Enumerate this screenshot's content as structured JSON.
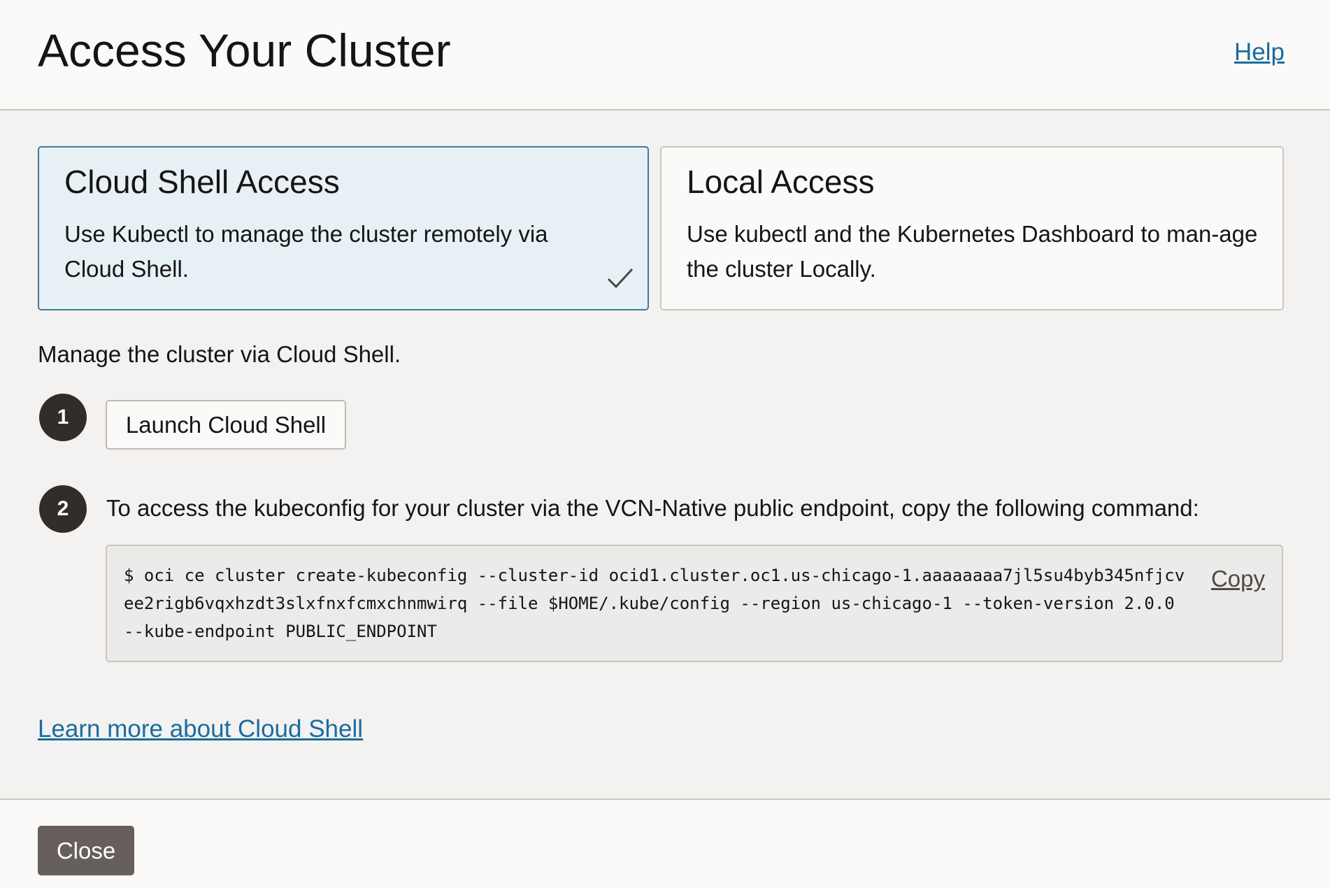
{
  "header": {
    "title": "Access Your Cluster",
    "help_label": "Help"
  },
  "cards": [
    {
      "title": "Cloud Shell Access",
      "description": "Use Kubectl to manage the cluster remotely via Cloud Shell.",
      "selected": true,
      "icon": "checkmark-icon"
    },
    {
      "title": "Local Access",
      "description": "Use kubectl and the Kubernetes Dashboard to man-age the cluster Locally.",
      "selected": false
    }
  ],
  "intro": "Manage the cluster via Cloud Shell.",
  "steps": [
    {
      "number": "1",
      "button_label": "Launch Cloud Shell"
    },
    {
      "number": "2",
      "text": "To access the kubeconfig for your cluster via the VCN-Native public endpoint, copy the following command:"
    }
  ],
  "command": {
    "text": "$ oci ce cluster create-kubeconfig --cluster-id ocid1.cluster.oc1.us-chicago-1.aaaaaaaa7jl5su4byb345nfjcvee2rigb6vqxhzdt3slxfnxfcmxchnmwirq --file $HOME/.kube/config --region us-chicago-1 --token-version 2.0.0 --kube-endpoint PUBLIC_ENDPOINT",
    "copy_label": "Copy"
  },
  "learn_more_label": "Learn more about Cloud Shell",
  "footer": {
    "close_label": "Close"
  },
  "colors": {
    "link": "#1b6ba0",
    "selected_card_bg": "#e7f1f5",
    "selected_card_border": "#3e7aa0",
    "close_button_bg": "#665f5b",
    "step_badge_bg": "#312d2a"
  }
}
